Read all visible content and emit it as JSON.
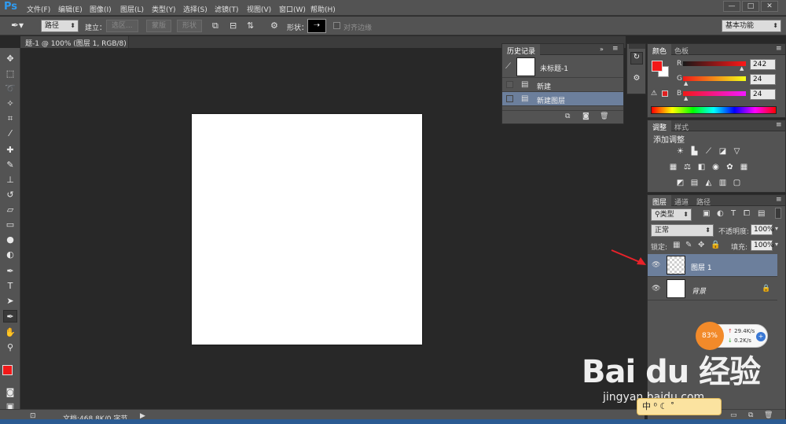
{
  "app": {
    "logo": "Ps"
  },
  "menubar": {
    "items": [
      "文件(F)",
      "编辑(E)",
      "图像(I)",
      "图层(L)",
      "类型(Y)",
      "选择(S)",
      "滤镜(T)",
      "视图(V)",
      "窗口(W)",
      "帮助(H)"
    ],
    "window_buttons": [
      "—",
      "□",
      "✕"
    ]
  },
  "options": {
    "tool_mode": "路径",
    "build_label": "建立：",
    "btn_selection": "选区...",
    "btn_mask": "蒙版",
    "btn_shape": "形状",
    "shape_label": "形状：",
    "align_edges": "对齐边缘",
    "workspace": "基本功能"
  },
  "document": {
    "tab_title": "题-1 @ 100% (图层 1, RGB/8) *",
    "tab_close": "×"
  },
  "status": {
    "doc_info": "文档:468.8K/0 字节"
  },
  "history": {
    "tabs": [
      "历史记录"
    ],
    "snapshot": "未标题-1",
    "items": [
      "新建",
      "新建图层"
    ]
  },
  "color": {
    "tabs": [
      "颜色",
      "色板"
    ],
    "channels": [
      {
        "label": "R",
        "value": "242"
      },
      {
        "label": "G",
        "value": "24"
      },
      {
        "label": "B",
        "value": "24"
      }
    ],
    "foreground": "#f21818",
    "background": "#ffffff"
  },
  "adjustments": {
    "tabs": [
      "调整",
      "样式"
    ],
    "title": "添加调整"
  },
  "layers": {
    "tabs": [
      "图层",
      "通道",
      "路径"
    ],
    "filter": "类型",
    "blend_mode": "正常",
    "opacity_label": "不透明度:",
    "opacity": "100%",
    "lock_label": "锁定:",
    "fill_label": "填充:",
    "fill": "100%",
    "items": [
      {
        "name": "图层 1",
        "selected": true
      },
      {
        "name": "背景",
        "selected": false
      }
    ]
  },
  "net_widget": {
    "percent": "83%",
    "up": "29.4K/s",
    "down": "0.2K/s"
  },
  "ime": {
    "text": "中 ⁰ ☾ ˚"
  },
  "watermark": {
    "brand": "Bai du 经验",
    "url": "jingyan.baidu.com"
  }
}
